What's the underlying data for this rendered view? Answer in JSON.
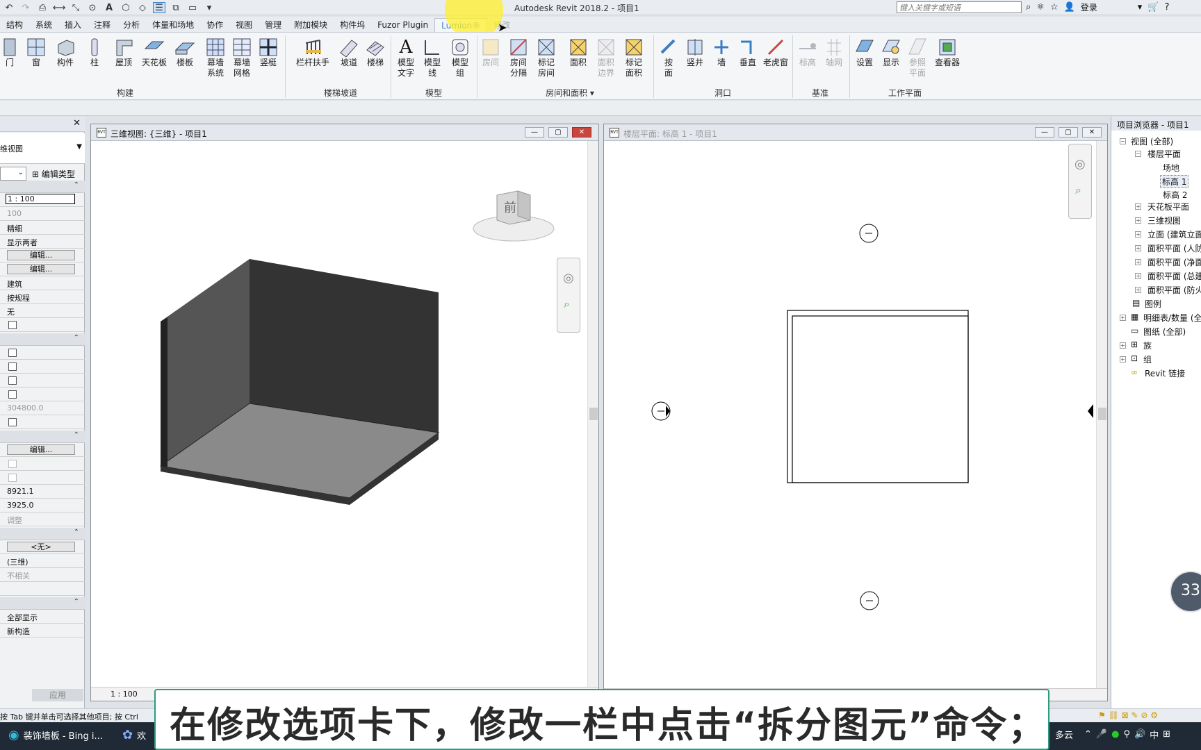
{
  "window": {
    "title": "Autodesk Revit 2018.2 -    项目1"
  },
  "search": {
    "placeholder": "键入关键字或短语"
  },
  "account": {
    "login": "登录"
  },
  "tabs": [
    "结构",
    "系统",
    "插入",
    "注释",
    "分析",
    "体量和场地",
    "协作",
    "视图",
    "管理",
    "附加模块",
    "构件坞",
    "Fuzor Plugin",
    "Lumion®",
    "修改"
  ],
  "active_tab": "Lumion®",
  "ribbon": {
    "build": {
      "door": "门",
      "window": "窗",
      "component": "构件",
      "column": "柱",
      "roof": "屋顶",
      "ceiling": "天花板",
      "floor": "楼板",
      "curtain_system": "幕墙\n系统",
      "curtain_grid": "幕墙\n网格",
      "mullion": "竖梃",
      "panel": "构建"
    },
    "circulation": {
      "railing": "栏杆扶手",
      "ramp": "坡道",
      "stair": "楼梯",
      "panel": "楼梯坡道"
    },
    "model": {
      "text": "模型\n文字",
      "line": "模型\n线",
      "group": "模型\n组",
      "panel": "模型"
    },
    "room": {
      "room": "房间",
      "separator": "房间\n分隔",
      "tag_room": "标记\n房间",
      "area": "面积",
      "area_boundary": "面积\n边界",
      "tag_area": "标记\n面积",
      "panel": "房间和面积 ▾"
    },
    "opening": {
      "by_face": "按\n面",
      "shaft": "竖井",
      "wall": "墙",
      "vertical": "垂直",
      "dormer": "老虎窗",
      "panel": "洞口"
    },
    "datum": {
      "level": "标高",
      "grid": "轴网",
      "panel": "基准"
    },
    "workplane": {
      "set": "设置",
      "show": "显示",
      "ref_plane": "参照\n平面",
      "viewer": "查看器",
      "panel": "工作平面"
    }
  },
  "properties": {
    "type_selector": "维视图",
    "edit_type": "编辑类型",
    "rows": {
      "scale": "1 : 100",
      "scale_value": "100",
      "detail": "精细",
      "parts": "显示两者",
      "edit": "编辑...",
      "discipline": "建筑",
      "display_hidden": "按规程",
      "default_analysis": "无",
      "far_clip": "304800.0",
      "eye_elevation": "8921.1",
      "target_elevation": "3925.0",
      "camera": "调整",
      "none_button": "<无>",
      "view_name": "(三维)",
      "dependency": "不相关",
      "phase_filter": "全部显示",
      "phase": "新构造"
    },
    "apply": "应用"
  },
  "view3d": {
    "title": "三维视图: {三维} - 项目1",
    "cube_label": "前",
    "scale": "1 : 100"
  },
  "plan": {
    "title": "楼层平面: 标高 1 - 项目1"
  },
  "browser": {
    "title": "项目浏览器 - 项目1",
    "items": [
      "视图 (全部)",
      "楼层平面",
      "场地",
      "标高 1",
      "标高 2",
      "天花板平面",
      "三维视图",
      "立面 (建筑立面",
      "面积平面 (人防",
      "面积平面 (净面",
      "面积平面 (总建",
      "面积平面 (防火",
      "图例",
      "明细表/数量 (全",
      "图纸 (全部)",
      "族",
      "组",
      "Revit 链接"
    ]
  },
  "status": {
    "hint": "按 Tab 键并单击可选择其他项目; 按 Ctrl"
  },
  "taskbar": {
    "edge_task": "装饰墙板 - Bing i...",
    "app_task": "欢",
    "weather": "多云",
    "ime": "中"
  },
  "timer": "33",
  "subtitle": "在修改选项卡下，修改一栏中点击“拆分图元”命令；"
}
